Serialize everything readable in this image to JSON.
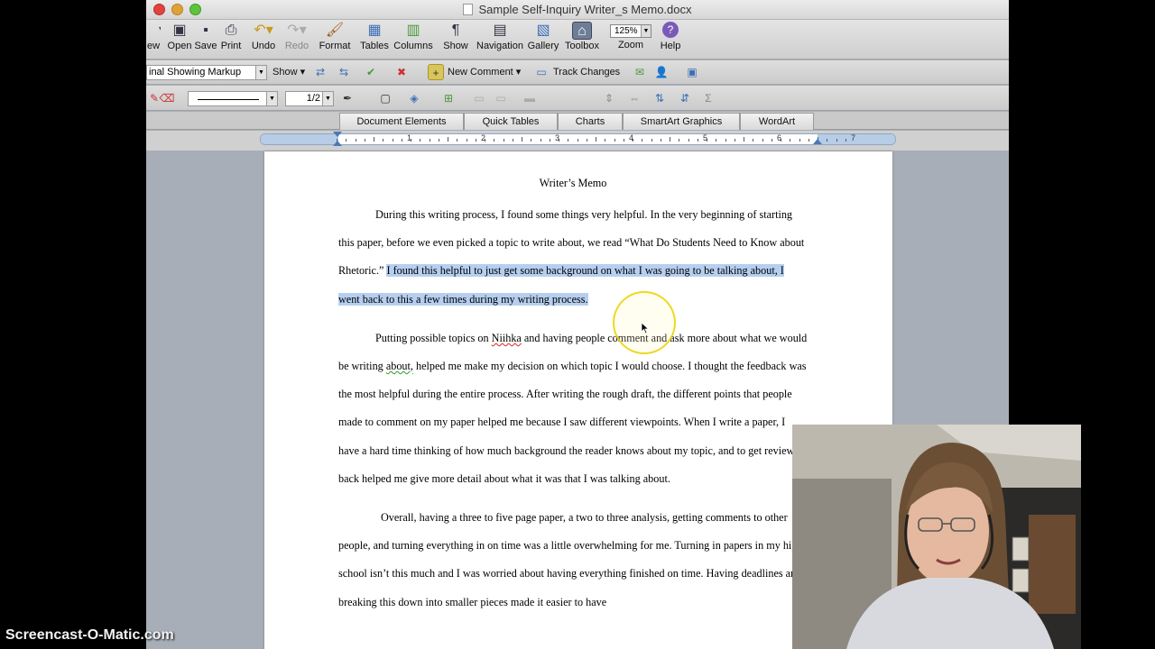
{
  "window": {
    "title": "Sample Self-Inquiry Writer_s Memo.docx"
  },
  "toolbar": {
    "items": [
      {
        "label": "ew",
        "icon": "new-icon"
      },
      {
        "label": "Open",
        "icon": "open-icon"
      },
      {
        "label": "Save",
        "icon": "save-icon"
      },
      {
        "label": "Print",
        "icon": "print-icon"
      },
      {
        "label": "Undo",
        "icon": "undo-icon"
      },
      {
        "label": "Redo",
        "icon": "redo-icon"
      },
      {
        "label": "Format",
        "icon": "format-icon"
      },
      {
        "label": "Tables",
        "icon": "tables-icon"
      },
      {
        "label": "Columns",
        "icon": "columns-icon"
      },
      {
        "label": "Show",
        "icon": "pilcrow-icon"
      },
      {
        "label": "Navigation",
        "icon": "navigation-icon"
      },
      {
        "label": "Gallery",
        "icon": "gallery-icon"
      },
      {
        "label": "Toolbox",
        "icon": "toolbox-icon"
      },
      {
        "label": "Zoom",
        "icon": "zoom-icon"
      },
      {
        "label": "Help",
        "icon": "help-icon"
      }
    ],
    "zoom_value": "125%"
  },
  "review": {
    "markup_view": "inal Showing Markup",
    "show_label": "Show",
    "new_comment": "New Comment",
    "track_changes": "Track Changes"
  },
  "formatting": {
    "line_weight": "1/2"
  },
  "ribbon": {
    "tabs": [
      "Document Elements",
      "Quick Tables",
      "Charts",
      "SmartArt Graphics",
      "WordArt"
    ]
  },
  "ruler": {
    "numbers": [
      "1",
      "2",
      "3",
      "4",
      "5",
      "6",
      "7"
    ]
  },
  "document": {
    "title": "Writer’s Memo",
    "p1_plain": "During this writing process, I found some things very helpful. In the very beginning of starting this paper, before we even picked a topic to write about, we read “What Do Students Need to Know about Rhetoric.” ",
    "p1_highlight": "I found this helpful to just get some background on what I was going to be talking about, I went back to this a few times during my writing process.",
    "p2_a": "Putting possible topics on ",
    "p2_word": "Niihka",
    "p2_b": " and having people comment and ask more about what we would be writing ",
    "p2_word2": "about,",
    "p2_c": " helped me make my decision on which topic I would choose. I thought the feedback was the most helpful during the entire process. After writing the rough draft, the different points that people made to comment on my paper helped me because I saw different viewpoints. When I write a paper, I have a hard time thinking of how much background the reader knows about my topic, and to get reviews back helped me give more detail about what it was that I was talking about.",
    "p3": "Overall, having a three to five page paper, a two to three analysis, getting comments to other people, and turning everything in on time was a little overwhelming for me. Turning in papers in my high school isn’t this much and I was worried about having everything finished on time. Having deadlines and breaking this down into smaller pieces made it easier to have"
  },
  "overlay": {
    "watermark": "Screencast-O-Matic.com"
  },
  "colors": {
    "selection": "#b6cff0",
    "cursor_ring": "#ebd200",
    "close": "#e0443e",
    "minimize": "#dea236",
    "zoom": "#5fc43a"
  }
}
